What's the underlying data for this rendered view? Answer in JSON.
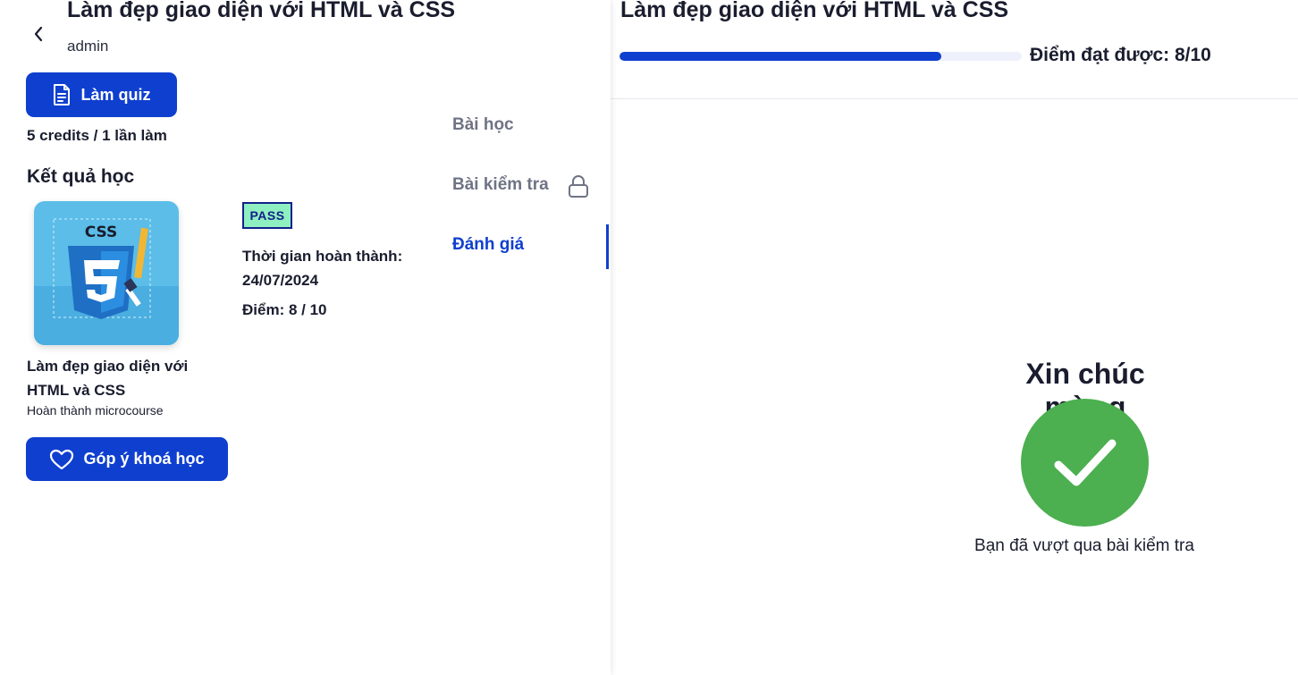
{
  "course": {
    "title": "Làm đẹp giao diện với HTML và CSS",
    "author": "admin"
  },
  "actions": {
    "quiz_label": "Làm quiz",
    "credits": "5 credits / 1 lần làm",
    "feedback_label": "Góp ý khoá học"
  },
  "results": {
    "heading": "Kết quả học",
    "thumbnail_text": "CSS",
    "course_name": "Làm đẹp giao diện với HTML và CSS",
    "course_sub": "Hoàn thành microcourse",
    "badge": "PASS",
    "completion_label": "Thời gian hoàn thành: 24/07/2024",
    "score_label": "Điểm: 8 / 10"
  },
  "nav": {
    "items": [
      {
        "label": "Bài học"
      },
      {
        "label": "Bài kiểm tra",
        "icon": "lock-icon"
      },
      {
        "label": "Đánh giá",
        "active": true
      }
    ]
  },
  "quiz_result": {
    "title": "Làm đẹp giao diện với HTML và CSS",
    "progress_fraction": 0.8,
    "score_text": "Điểm đạt được: 8/10",
    "congrats": "Xin chúc mừng",
    "passed_message": "Bạn đã vượt qua bài kiểm tra"
  },
  "colors": {
    "primary": "#0f3fcf",
    "success": "#4caf50",
    "badge_bg": "#8ef0c0",
    "badge_border": "#14208a",
    "muted": "#6f7384"
  }
}
